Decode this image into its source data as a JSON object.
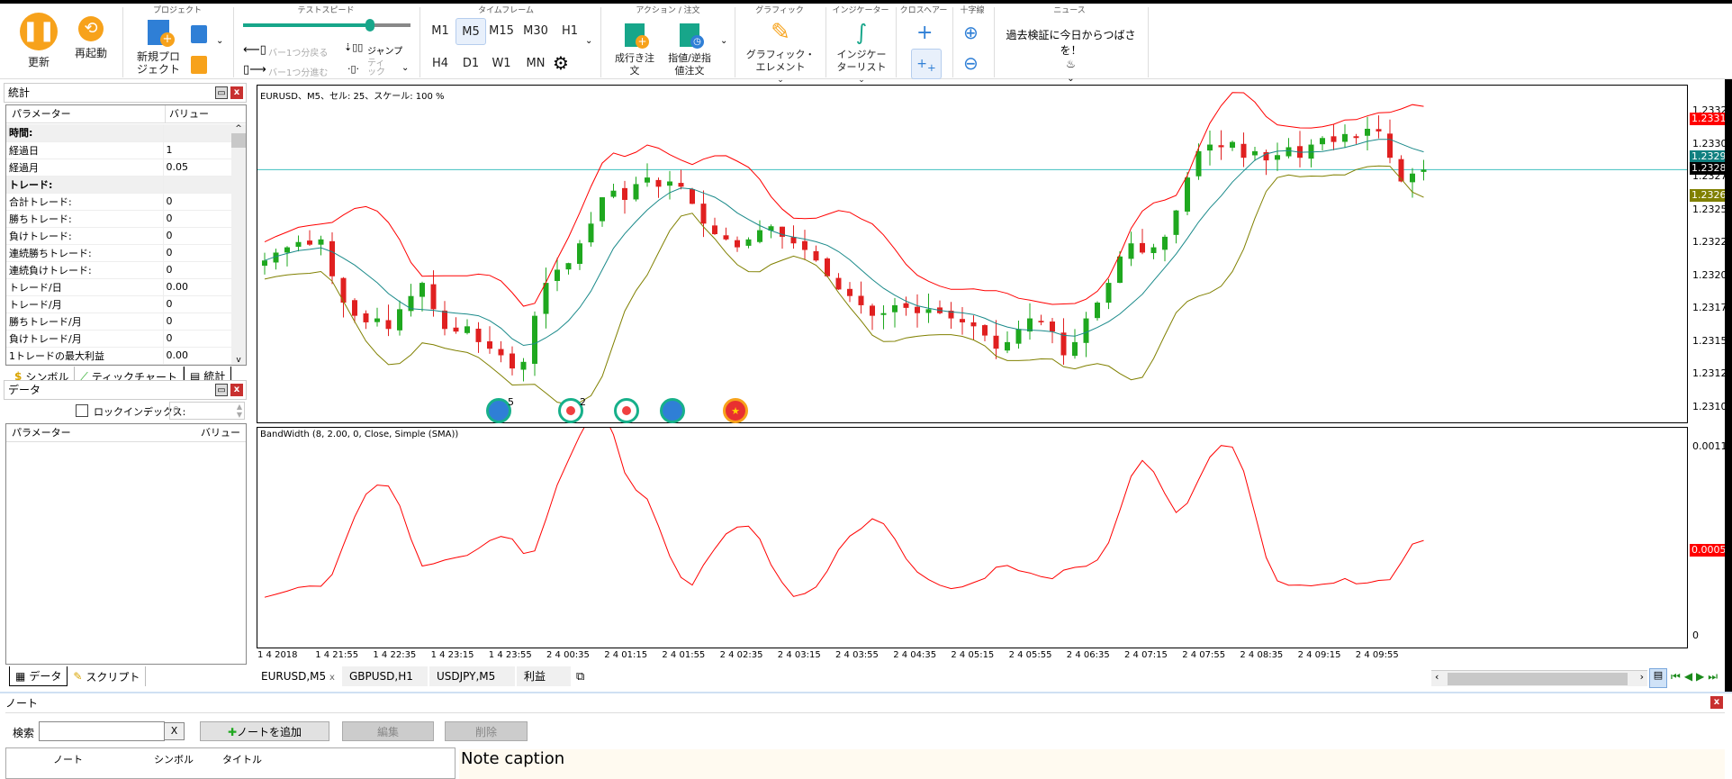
{
  "toolbar": {
    "update": "更新",
    "restart": "再起動",
    "groups": {
      "project": "プロジェクト",
      "speed": "テストスピード",
      "timeframe": "タイムフレーム",
      "action": "アクション / 注文",
      "graphic": "グラフィック",
      "indicator": "インジケーター",
      "crosshair": "クロスヘアー",
      "cross": "十字線",
      "news": "ニュース"
    },
    "new_project": [
      "新規プロ",
      "ジェクト"
    ],
    "bar_back": "バー1つ分戻る",
    "bar_forward": "バー1つ分進む",
    "jump": "ジャンプ",
    "tick": [
      "ティ",
      "ック"
    ],
    "speed_level": 0.76,
    "timeframes": [
      "M1",
      "M5",
      "M15",
      "M30",
      "H1",
      "H4",
      "D1",
      "W1",
      "MN"
    ],
    "selected_timeframe": "M5",
    "market_order": [
      "成行き注",
      "文"
    ],
    "limit_order": [
      "指値/逆指",
      "値注文"
    ],
    "graphic_elements": [
      "グラフィック・",
      "エレメント"
    ],
    "indicator_list": [
      "インジケー",
      "ターリスト"
    ],
    "news_text": "過去検証に今日からつばさを！"
  },
  "stats_panel": {
    "title": "統計",
    "col_param": "パラメーター",
    "col_value": "バリュー",
    "rows": [
      {
        "label": "時間:",
        "section": true
      },
      {
        "label": "経過日",
        "value": "1"
      },
      {
        "label": "経過月",
        "value": "0.05"
      },
      {
        "label": "トレード:",
        "section": true
      },
      {
        "label": "合計トレード:",
        "value": "0"
      },
      {
        "label": "勝ちトレード:",
        "value": "0"
      },
      {
        "label": "負けトレード:",
        "value": "0"
      },
      {
        "label": "連続勝ちトレード:",
        "value": "0"
      },
      {
        "label": "連続負けトレード:",
        "value": "0"
      },
      {
        "label": "トレード/日",
        "value": "0.00"
      },
      {
        "label": "トレード/月",
        "value": "0"
      },
      {
        "label": "勝ちトレード/月",
        "value": "0"
      },
      {
        "label": "負けトレード/月",
        "value": "0"
      },
      {
        "label": "1トレードの最大利益",
        "value": "0.00"
      }
    ],
    "tabs": [
      "シンボル",
      "ティックチャート",
      "統計"
    ]
  },
  "data_panel": {
    "title": "データ",
    "lock_label": "ロックインデックス:",
    "lock_value": "0",
    "col_param": "パラメーター",
    "col_value": "バリュー",
    "tabs": [
      "データ",
      "スクリプト"
    ]
  },
  "chart": {
    "title": "EURUSD、M5、セル: 25、スケール: 100 %",
    "indicator_title": "BandWidth (8, 2.00, 0, Close, Simple (SMA))",
    "colors": {
      "up": "#1fa81f",
      "down": "#e02020",
      "upper": "#ff0000",
      "mid": "#1a8a8a",
      "lower": "#808000",
      "bandwidth": "#ff0000",
      "price_line": "#40c0c0"
    },
    "price_ticks": [
      "1.23325",
      "1.23300",
      "1.23275",
      "1.23250",
      "1.23225",
      "1.23200",
      "1.23175",
      "1.23150",
      "1.23125",
      "1.23100"
    ],
    "price_tags": [
      {
        "value": "1.23319",
        "color": "#ff0000"
      },
      {
        "value": "1.23290",
        "color": "#108080"
      },
      {
        "value": "1.23281",
        "color": "#000000"
      },
      {
        "value": "1.23261",
        "color": "#808000"
      }
    ],
    "ind_ticks": [
      "0.0011",
      "0.0005",
      "0"
    ],
    "time_labels": [
      "1 4 2018",
      "1 4 21:55",
      "1 4 22:35",
      "1 4 23:15",
      "1 4 23:55",
      "2 4 00:35",
      "2 4 01:15",
      "2 4 01:55",
      "2 4 02:35",
      "2 4 03:15",
      "2 4 03:55",
      "2 4 04:35",
      "2 4 05:15",
      "2 4 05:55",
      "2 4 06:35",
      "2 4 07:15",
      "2 4 07:55",
      "2 4 08:35",
      "2 4 09:15",
      "2 4 09:55"
    ],
    "event_counts": [
      "5",
      "2"
    ],
    "closes": [
      1.23212,
      1.23218,
      1.23222,
      1.23226,
      1.23224,
      1.23228,
      1.232,
      1.2318,
      1.2317,
      1.23165,
      1.23168,
      1.2316,
      1.23175,
      1.23185,
      1.23195,
      1.23175,
      1.2316,
      1.23158,
      1.23162,
      1.2315,
      1.23145,
      1.2314,
      1.2313,
      1.23135,
      1.2317,
      1.23195,
      1.23205,
      1.2321,
      1.23225,
      1.2324,
      1.2326,
      1.23265,
      1.23258,
      1.2327,
      1.23275,
      1.23268,
      1.23272,
      1.23268,
      1.23255,
      1.2324,
      1.23232,
      1.23228,
      1.23222,
      1.23228,
      1.23235,
      1.23238,
      1.2323,
      1.23225,
      1.2322,
      1.23212,
      1.232,
      1.2319,
      1.23185,
      1.23178,
      1.2317,
      1.23172,
      1.23178,
      1.23176,
      1.23172,
      1.23175,
      1.23172,
      1.23168,
      1.23165,
      1.23162,
      1.23155,
      1.23145,
      1.2315,
      1.2316,
      1.23168,
      1.23165,
      1.23158,
      1.2314,
      1.2315,
      1.23168,
      1.2318,
      1.23195,
      1.23215,
      1.23225,
      1.23218,
      1.23222,
      1.2323,
      1.2325,
      1.23275,
      1.23295,
      1.233,
      1.23298,
      1.23302,
      1.2329,
      1.23295,
      1.23288,
      1.23292,
      1.23298,
      1.2329,
      1.233,
      1.23305,
      1.23302,
      1.23308,
      1.23305,
      1.23312,
      1.2331,
      1.2329,
      1.23272,
      1.23278,
      1.23281
    ]
  },
  "chart_tabs": [
    "EURUSD,M5",
    "GBPUSD,H1",
    "USDJPY,M5",
    "利益"
  ],
  "notes": {
    "title": "ノート",
    "search_label": "検索",
    "search_value": "",
    "clear": "X",
    "add": "ノートを追加",
    "edit": "編集",
    "delete": "削除",
    "cols": [
      "ノート",
      "シンボル",
      "タイトル"
    ],
    "caption": "Note caption"
  }
}
